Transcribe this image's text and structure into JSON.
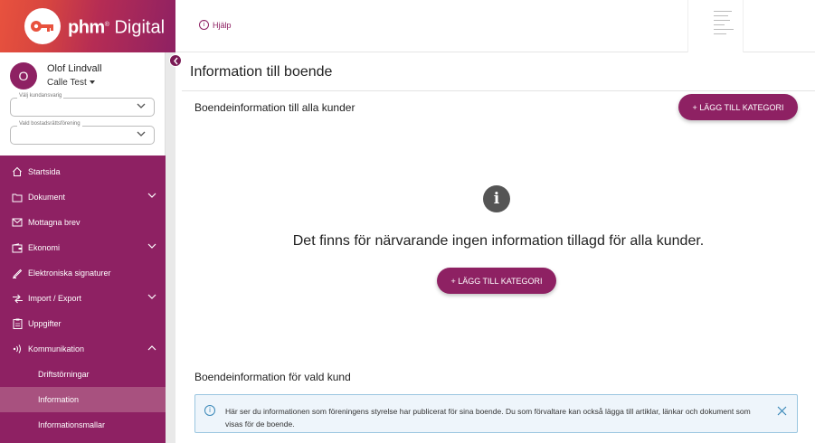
{
  "brand": {
    "name": "phm",
    "suffix": "Digital"
  },
  "colors": {
    "primary": "#8e2163",
    "sidebar": "#8e2163",
    "active_sub": "#a8517f",
    "info_border": "#9ac6e0",
    "info_bg": "#eef5fb"
  },
  "user": {
    "initial": "O",
    "name": "Olof Lindvall",
    "company": "Calle Test"
  },
  "selects": [
    {
      "label": "Välj kundansvarig",
      "value": ""
    },
    {
      "label": "Vald bostadsrättsförening",
      "value": ""
    }
  ],
  "nav": {
    "items": [
      {
        "label": "Startsida",
        "icon": "home-icon",
        "expandable": false
      },
      {
        "label": "Dokument",
        "icon": "folder-icon",
        "expandable": true
      },
      {
        "label": "Mottagna brev",
        "icon": "mail-icon",
        "expandable": false
      },
      {
        "label": "Ekonomi",
        "icon": "wallet-icon",
        "expandable": true
      },
      {
        "label": "Elektroniska signaturer",
        "icon": "pen-icon",
        "expandable": false
      },
      {
        "label": "Import / Export",
        "icon": "import-export-icon",
        "expandable": true
      },
      {
        "label": "Uppgifter",
        "icon": "clipboard-icon",
        "expandable": false
      },
      {
        "label": "Kommunikation",
        "icon": "broadcast-icon",
        "expandable": true,
        "expanded": true
      }
    ],
    "subitems": [
      {
        "label": "Driftstörningar",
        "active": false
      },
      {
        "label": "Information",
        "active": true
      },
      {
        "label": "Informationsmallar",
        "active": false
      }
    ]
  },
  "header": {
    "help_label": "Hjälp"
  },
  "main": {
    "title": "Information till boende",
    "section_all": "Boendeinformation till alla kunder",
    "add_button": "+ LÄGG TILL KATEGORI",
    "empty_message": "Det finns för närvarande ingen information tillagd för alla kunder.",
    "section_selected": "Boendeinformation för vald kund",
    "banner_text": "Här ser du informationen som föreningens styrelse har publicerat för sina boende. Du som förvaltare kan också lägga till artiklar, länkar och dokument som visas för de boende."
  }
}
